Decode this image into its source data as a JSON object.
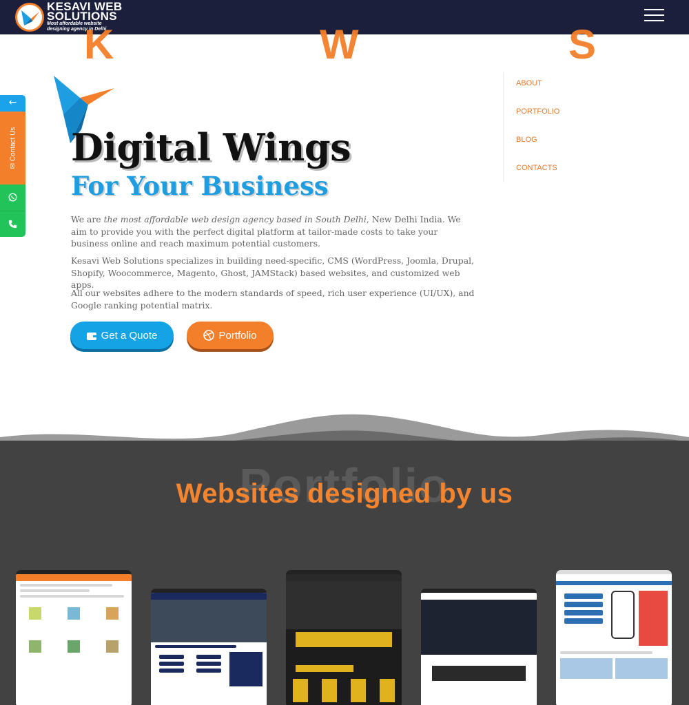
{
  "header": {
    "logo_title_1": "KESAVI WEB",
    "logo_title_2": "SOLUTIONS",
    "logo_tagline_1": "Most affordable website",
    "logo_tagline_2": "designing agency in Delhi"
  },
  "letters": [
    "K",
    "W",
    "S"
  ],
  "nav": {
    "items": [
      "ABOUT",
      "PORTFOLIO",
      "BLOG",
      "CONTACTS"
    ]
  },
  "left_tab": {
    "arrow": "←",
    "contact": "✉ Contact Us"
  },
  "hero": {
    "title": "Digital Wings",
    "subtitle": "For Your Business",
    "p1_pre": "We are ",
    "p1_em": "the most affordable web design agency based in South Delhi",
    "p1_post": ", New Delhi India. We aim to provide you with the perfect digital platform at tailor-made costs to take your business online and reach maximum potential customers.",
    "p2": "Kesavi Web Solutions specializes in building need-specific, CMS (WordPress, Joomla, Drupal, Shopify, Woocommerce, Magento, Ghost, JAMStack) based websites, and customized web apps.",
    "p3": "All our websites adhere to the modern standards of speed, rich user experience (UI/UX), and Google ranking potential matrix.",
    "btn_quote": "Get a Quote",
    "btn_portfolio": "Portfolio"
  },
  "portfolio": {
    "bg_word": "Portfolio",
    "title": "Websites designed by us"
  },
  "colors": {
    "navy": "#1b1f3b",
    "orange": "#f47f2a",
    "blue": "#1e9de0",
    "green": "#22c45a",
    "dark": "#424242"
  }
}
